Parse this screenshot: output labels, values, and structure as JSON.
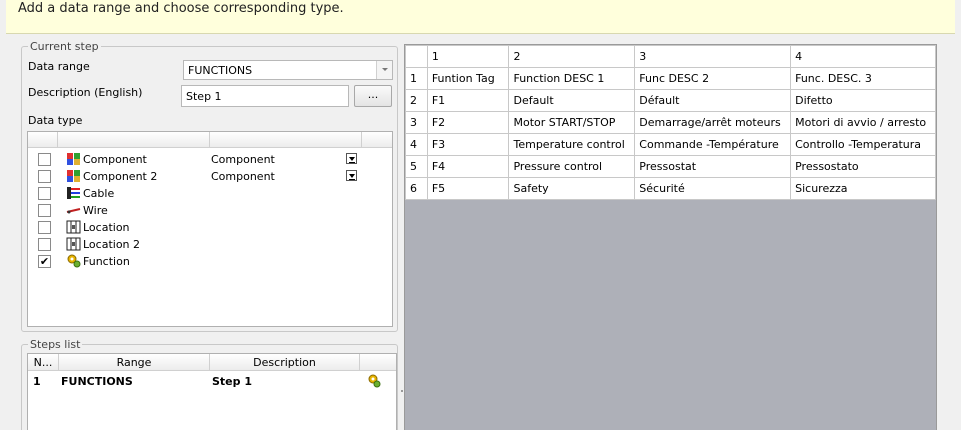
{
  "banner": {
    "subtitle": "Add a data range and choose corresponding type."
  },
  "current_step": {
    "legend": "Current step",
    "data_range_label": "Data range",
    "data_range_value": "FUNCTIONS",
    "description_label": "Description (English)",
    "description_value": "Step 1",
    "browse_label": "...",
    "data_type_label": "Data type",
    "types": [
      {
        "checked": false,
        "name": "Component",
        "value": "Component",
        "dropdown": true,
        "icon": "component-icon"
      },
      {
        "checked": false,
        "name": "Component 2",
        "value": "Component",
        "dropdown": true,
        "icon": "component-icon"
      },
      {
        "checked": false,
        "name": "Cable",
        "value": "",
        "dropdown": false,
        "icon": "cable-icon"
      },
      {
        "checked": false,
        "name": "Wire",
        "value": "",
        "dropdown": false,
        "icon": "wire-icon"
      },
      {
        "checked": false,
        "name": "Location",
        "value": "",
        "dropdown": false,
        "icon": "location-icon"
      },
      {
        "checked": false,
        "name": "Location 2",
        "value": "",
        "dropdown": false,
        "icon": "location-icon"
      },
      {
        "checked": true,
        "name": "Function",
        "value": "",
        "dropdown": false,
        "icon": "function-icon"
      }
    ],
    "check_mark": "✔"
  },
  "steps_list": {
    "legend": "Steps list",
    "columns": [
      "N...",
      "Range",
      "Description"
    ],
    "rows": [
      {
        "n": "1",
        "range": "FUNCTIONS",
        "description": "Step 1",
        "icon": "function-icon"
      }
    ]
  },
  "grid": {
    "columns": [
      "1",
      "2",
      "3",
      "4"
    ],
    "rows": [
      {
        "n": "1",
        "cells": [
          "Funtion Tag",
          "Function DESC 1",
          "Func DESC 2",
          "Func. DESC. 3"
        ]
      },
      {
        "n": "2",
        "cells": [
          "F1",
          "Default",
          "Défault",
          "Difetto"
        ]
      },
      {
        "n": "3",
        "cells": [
          "F2",
          "Motor START/STOP",
          "Demarrage/arrêt moteurs",
          "Motori di avvio / arresto"
        ]
      },
      {
        "n": "4",
        "cells": [
          "F3",
          "Temperature control",
          "Commande -Température",
          "Controllo -Temperatura"
        ]
      },
      {
        "n": "5",
        "cells": [
          "F4",
          "Pressure control",
          "Pressostat",
          "Pressostato"
        ]
      },
      {
        "n": "6",
        "cells": [
          "F5",
          "Safety",
          "Sécurité",
          "Sicurezza"
        ]
      }
    ]
  }
}
